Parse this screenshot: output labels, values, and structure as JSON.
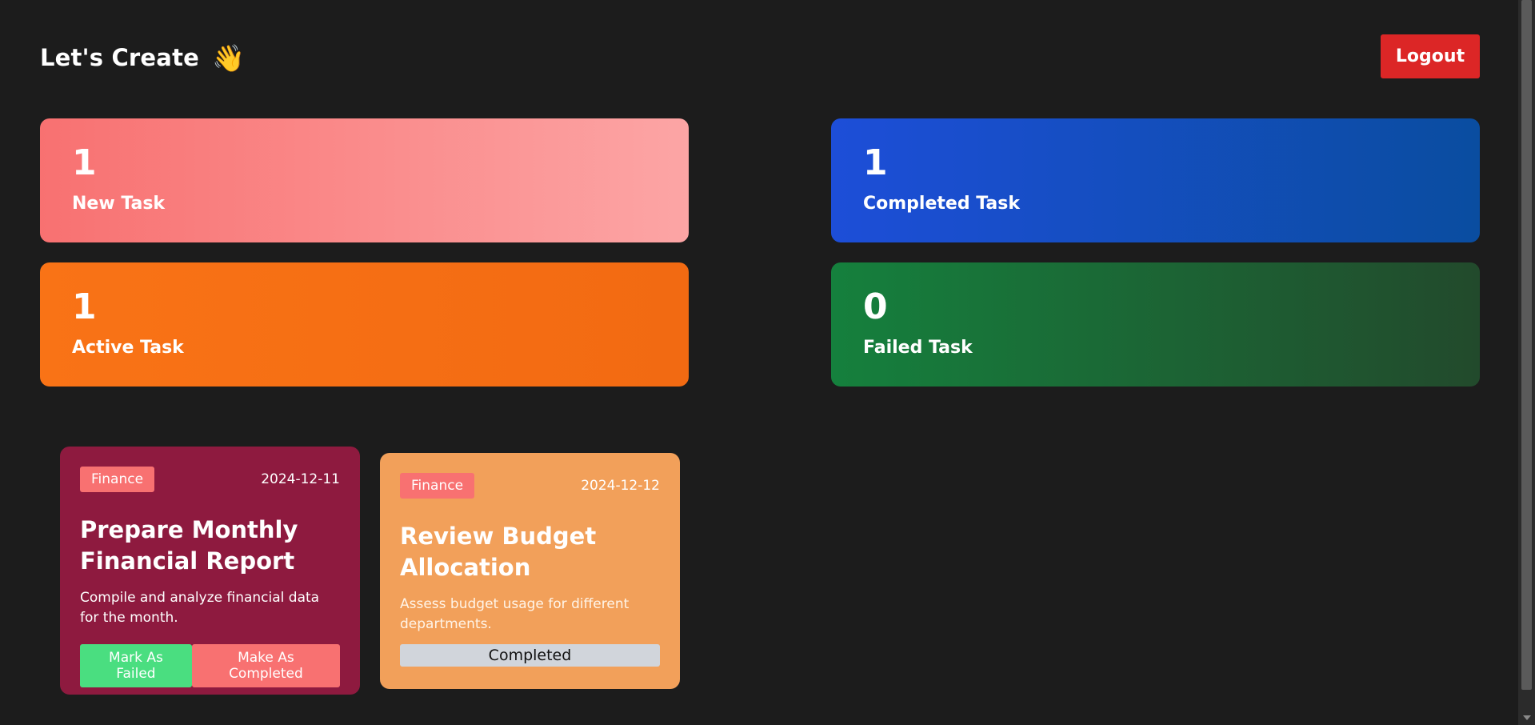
{
  "header": {
    "greeting": "Let's Create",
    "wave_emoji": "👋",
    "logout_label": "Logout"
  },
  "stats": {
    "new": {
      "count": "1",
      "label": "New Task"
    },
    "completed": {
      "count": "1",
      "label": "Completed Task"
    },
    "active": {
      "count": "1",
      "label": "Active Task"
    },
    "failed": {
      "count": "0",
      "label": "Failed Task"
    }
  },
  "tasks": [
    {
      "category": "Finance",
      "date": "2024-12-11",
      "title": "Prepare Monthly Financial Report",
      "description": "Compile and analyze financial data for the month.",
      "fail_label": "Mark As Failed",
      "complete_label": "Make As Completed"
    },
    {
      "category": "Finance",
      "date": "2024-12-12",
      "title": "Review Budget Allocation",
      "description": "Assess budget usage for different departments.",
      "status": "Completed"
    }
  ],
  "colors": {
    "background": "#1c1c1c",
    "logout": "#dc2626",
    "new_task": "#f87171",
    "completed_task": "#1d4ed8",
    "active_task": "#f97316",
    "failed_task": "#15803d",
    "task_card_active": "#8e1a3f",
    "task_card_completed": "#f2a05a"
  }
}
